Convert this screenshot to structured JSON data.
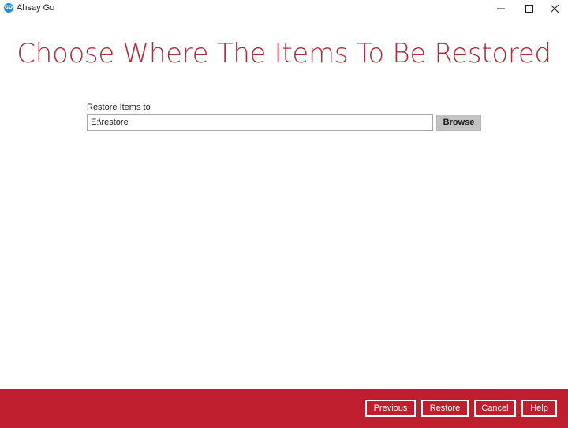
{
  "window": {
    "title": "Ahsay Go",
    "icon_text": "GO",
    "controls": {
      "minimize": "minimize-icon",
      "maximize": "maximize-icon",
      "close": "close-icon"
    }
  },
  "main": {
    "heading": "Choose Where The Items To Be Restored",
    "restore_label": "Restore Items to",
    "restore_path": "E:\\restore",
    "browse_label": "Browse"
  },
  "footer": {
    "previous_label": "Previous",
    "restore_label": "Restore",
    "cancel_label": "Cancel",
    "help_label": "Help"
  },
  "colors": {
    "accent": "#be1e2d",
    "heading": "#b22a3a",
    "browse_button": "#c2c2c2"
  }
}
